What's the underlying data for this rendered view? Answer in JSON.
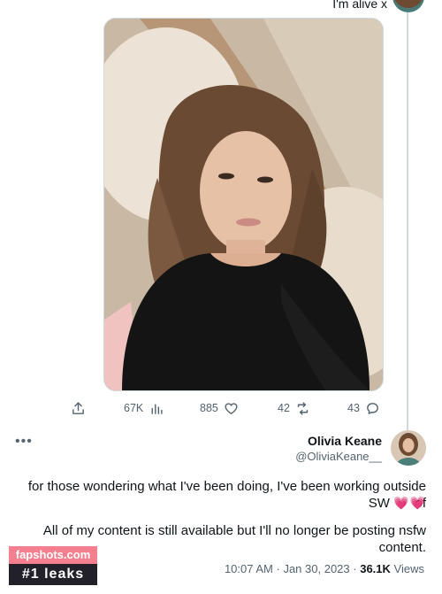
{
  "top_tweet": {
    "text": "I'm alive x"
  },
  "actions": {
    "reply_count": "43",
    "retweet_count": "42",
    "like_count": "885",
    "views_count": "67K"
  },
  "tweet": {
    "display_name": "Olivia Keane",
    "handle": "@OliviaKeane__",
    "text_line1": "for those wondering what I've been doing, I've been working outside of",
    "text_line2_prefix": "SW",
    "text_line2_emoji": "💗💗",
    "text_para2": "All of my content is still available but I'll no longer be posting nsfw content.",
    "meta": {
      "time": "10:07 AM",
      "date": "Jan 30, 2023",
      "views_value": "36.1K",
      "views_label": "Views"
    }
  },
  "watermark": {
    "site": "fapshots.com",
    "tagline": "#1 leaks"
  },
  "icons": [
    "reply-icon",
    "retweet-icon",
    "like-icon",
    "views-icon",
    "share-icon",
    "more-icon"
  ]
}
